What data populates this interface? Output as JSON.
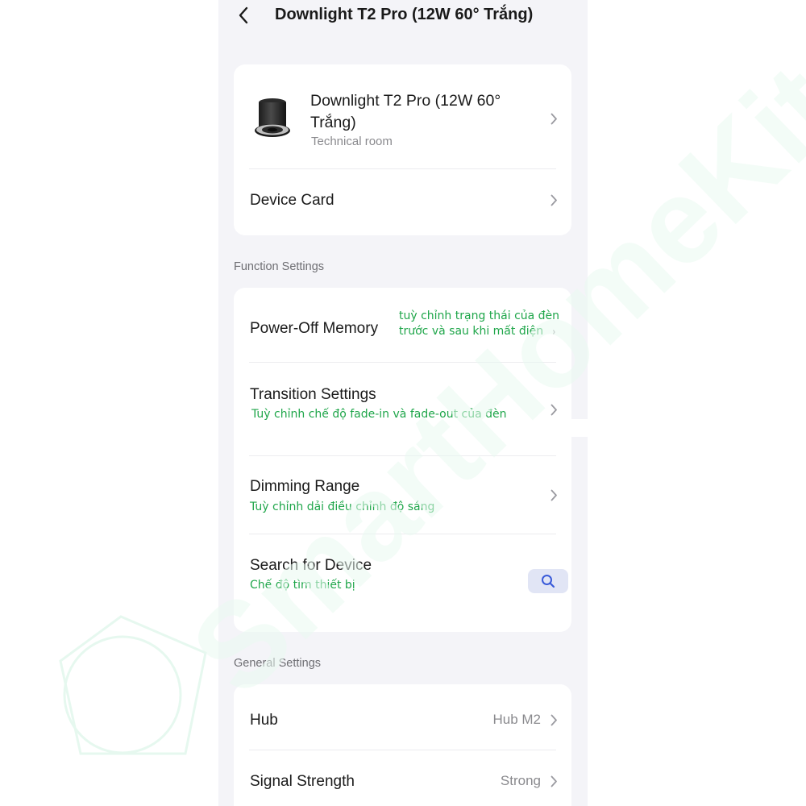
{
  "header": {
    "title": "Downlight T2 Pro (12W 60° Trắng)"
  },
  "device": {
    "name": "Downlight T2 Pro (12W 60° Trắng)",
    "room": "Technical room"
  },
  "device_card_label": "Device Card",
  "function_settings": {
    "title": "Function Settings",
    "items": [
      {
        "label": "Power-Off Memory",
        "note_line1": "tuỳ chỉnh trạng thái của đèn",
        "note_line2": "trước và sau khi mất điện"
      },
      {
        "label": "Transition Settings",
        "note": "Tuỳ chỉnh chế độ fade-in và fade-out của đèn"
      },
      {
        "label": "Dimming Range",
        "note": "Tuỳ chỉnh dải điều chỉnh độ sáng"
      },
      {
        "label": "Search for Device",
        "note": "Chế độ tìm thiết bị"
      }
    ]
  },
  "general_settings": {
    "title": "General Settings",
    "items": [
      {
        "label": "Hub",
        "value": "Hub M2"
      },
      {
        "label": "Signal Strength",
        "value": "Strong"
      }
    ]
  },
  "watermark": {
    "text": "SmartHomeKit"
  },
  "colors": {
    "background": "#f4f4f8",
    "card": "#ffffff",
    "note_green": "#1fa64a",
    "search_button": "#e1e5f5",
    "search_icon": "#3a5bd9",
    "watermark": "#e6f8ef"
  },
  "icons": {
    "back": "chevron-left-icon",
    "row_arrow": "chevron-right-icon",
    "search": "search-icon",
    "device": "downlight-product-image"
  }
}
